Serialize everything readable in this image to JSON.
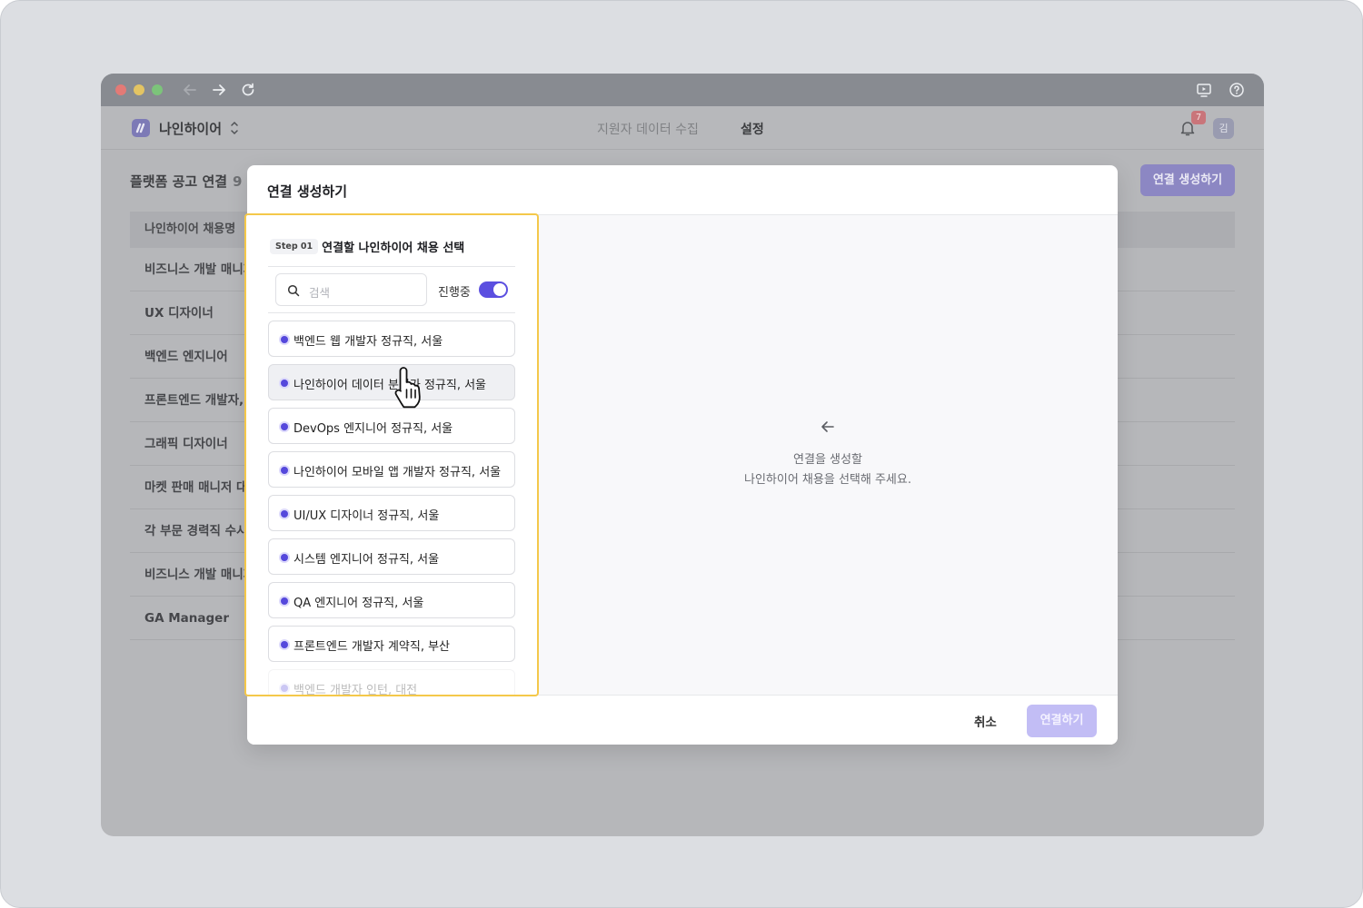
{
  "browser": {
    "back_icon": "arrow-left-icon",
    "forward_icon": "arrow-right-icon",
    "reload_icon": "reload-icon",
    "screen_icon": "screen-share-icon",
    "help_icon": "help-circle-icon"
  },
  "appbar": {
    "org_name": "나인하이어",
    "org_toggle": "⌃\n⌄",
    "tabs": [
      "지원자 데이터 수집",
      "설정"
    ],
    "notification_count": "7",
    "avatar_initial": "김"
  },
  "page": {
    "title": "플랫폼 공고 연결",
    "count": "9",
    "create_button": "연결 생성하기",
    "table_header": "나인하이어 채용명",
    "rows": [
      "비즈니스 개발 매니저",
      "UX 디자이너",
      "백엔드 엔지니어",
      "프론트엔드 개발자, 주",
      "그래픽 디자이너",
      "마켓 판매 매니저 대규",
      "각 부문 경력직 수시채",
      "비즈니스 개발 매니저",
      "GA Manager"
    ]
  },
  "modal": {
    "title": "연결 생성하기",
    "step_chip": "Step 01",
    "step_title": "연결할 나인하이어 채용 선택",
    "search_placeholder": "검색",
    "toggle_label": "진행중",
    "toggle_on": true,
    "jobs": [
      "백엔드 웹 개발자 정규직, 서울",
      "나인하이어 데이터 분석가 정규직, 서울",
      "DevOps 엔지니어 정규직, 서울",
      "나인하이어 모바일 앱 개발자 정규직, 서울",
      "UI/UX 디자이너 정규직, 서울",
      "시스템 엔지니어 정규직, 서울",
      "QA 엔지니어 정규직, 서울",
      "프론트엔드 개발자 계약직, 부산",
      "백엔드 개발자 인턴, 대전"
    ],
    "empty_line1": "연결을 생성할",
    "empty_line2": "나인하이어 채용을 선택해 주세요.",
    "cancel_button": "취소",
    "connect_button": "연결하기"
  },
  "colors": {
    "accent": "#5b4fe0",
    "highlight_border": "#f4c84a",
    "connect_disabled": "#c2bdf5"
  }
}
